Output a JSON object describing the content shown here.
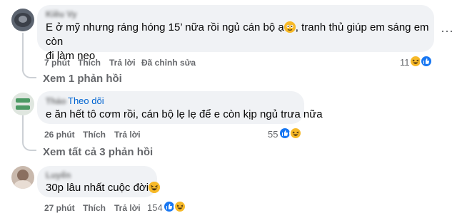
{
  "comments": [
    {
      "author": "Kiều Vy",
      "text_line1": "E ở mỹ nhưng ráng hóng 15’ nữa rồi ngủ cán bộ ạ",
      "text_line1_after": ", tranh thủ giúp em sáng em còn",
      "text_line2": "đi làm neo",
      "time": "7 phút",
      "like": "Thích",
      "reply": "Trả lời",
      "edited": "Đã chỉnh sửa",
      "reaction_count": "11",
      "more_icon": "⋯"
    },
    {
      "author": "Thảo",
      "follow": "Theo dõi",
      "text": "e ăn hết tô cơm rồi, cán bộ lẹ lẹ để e còn kịp ngủ trưa nữa",
      "time": "26 phút",
      "like": "Thích",
      "reply": "Trả lời",
      "reaction_count": "55"
    },
    {
      "author": "Luyến",
      "text": "30p lâu nhất cuộc đời",
      "time": "27 phút",
      "like": "Thích",
      "reply": "Trả lời",
      "reaction_count": "154"
    }
  ],
  "replies_link_1": "Xem 1 phản hồi",
  "replies_link_2": "Xem tất cả 3 phản hồi",
  "colors": {
    "like": "#1877f2",
    "haha": "#f7b928",
    "link": "#0064d1",
    "meta": "#65676b",
    "bubble": "#f0f2f5"
  },
  "icons": [
    "avatar",
    "haha-icon",
    "like-icon",
    "more-icon",
    "emoji-icon"
  ]
}
